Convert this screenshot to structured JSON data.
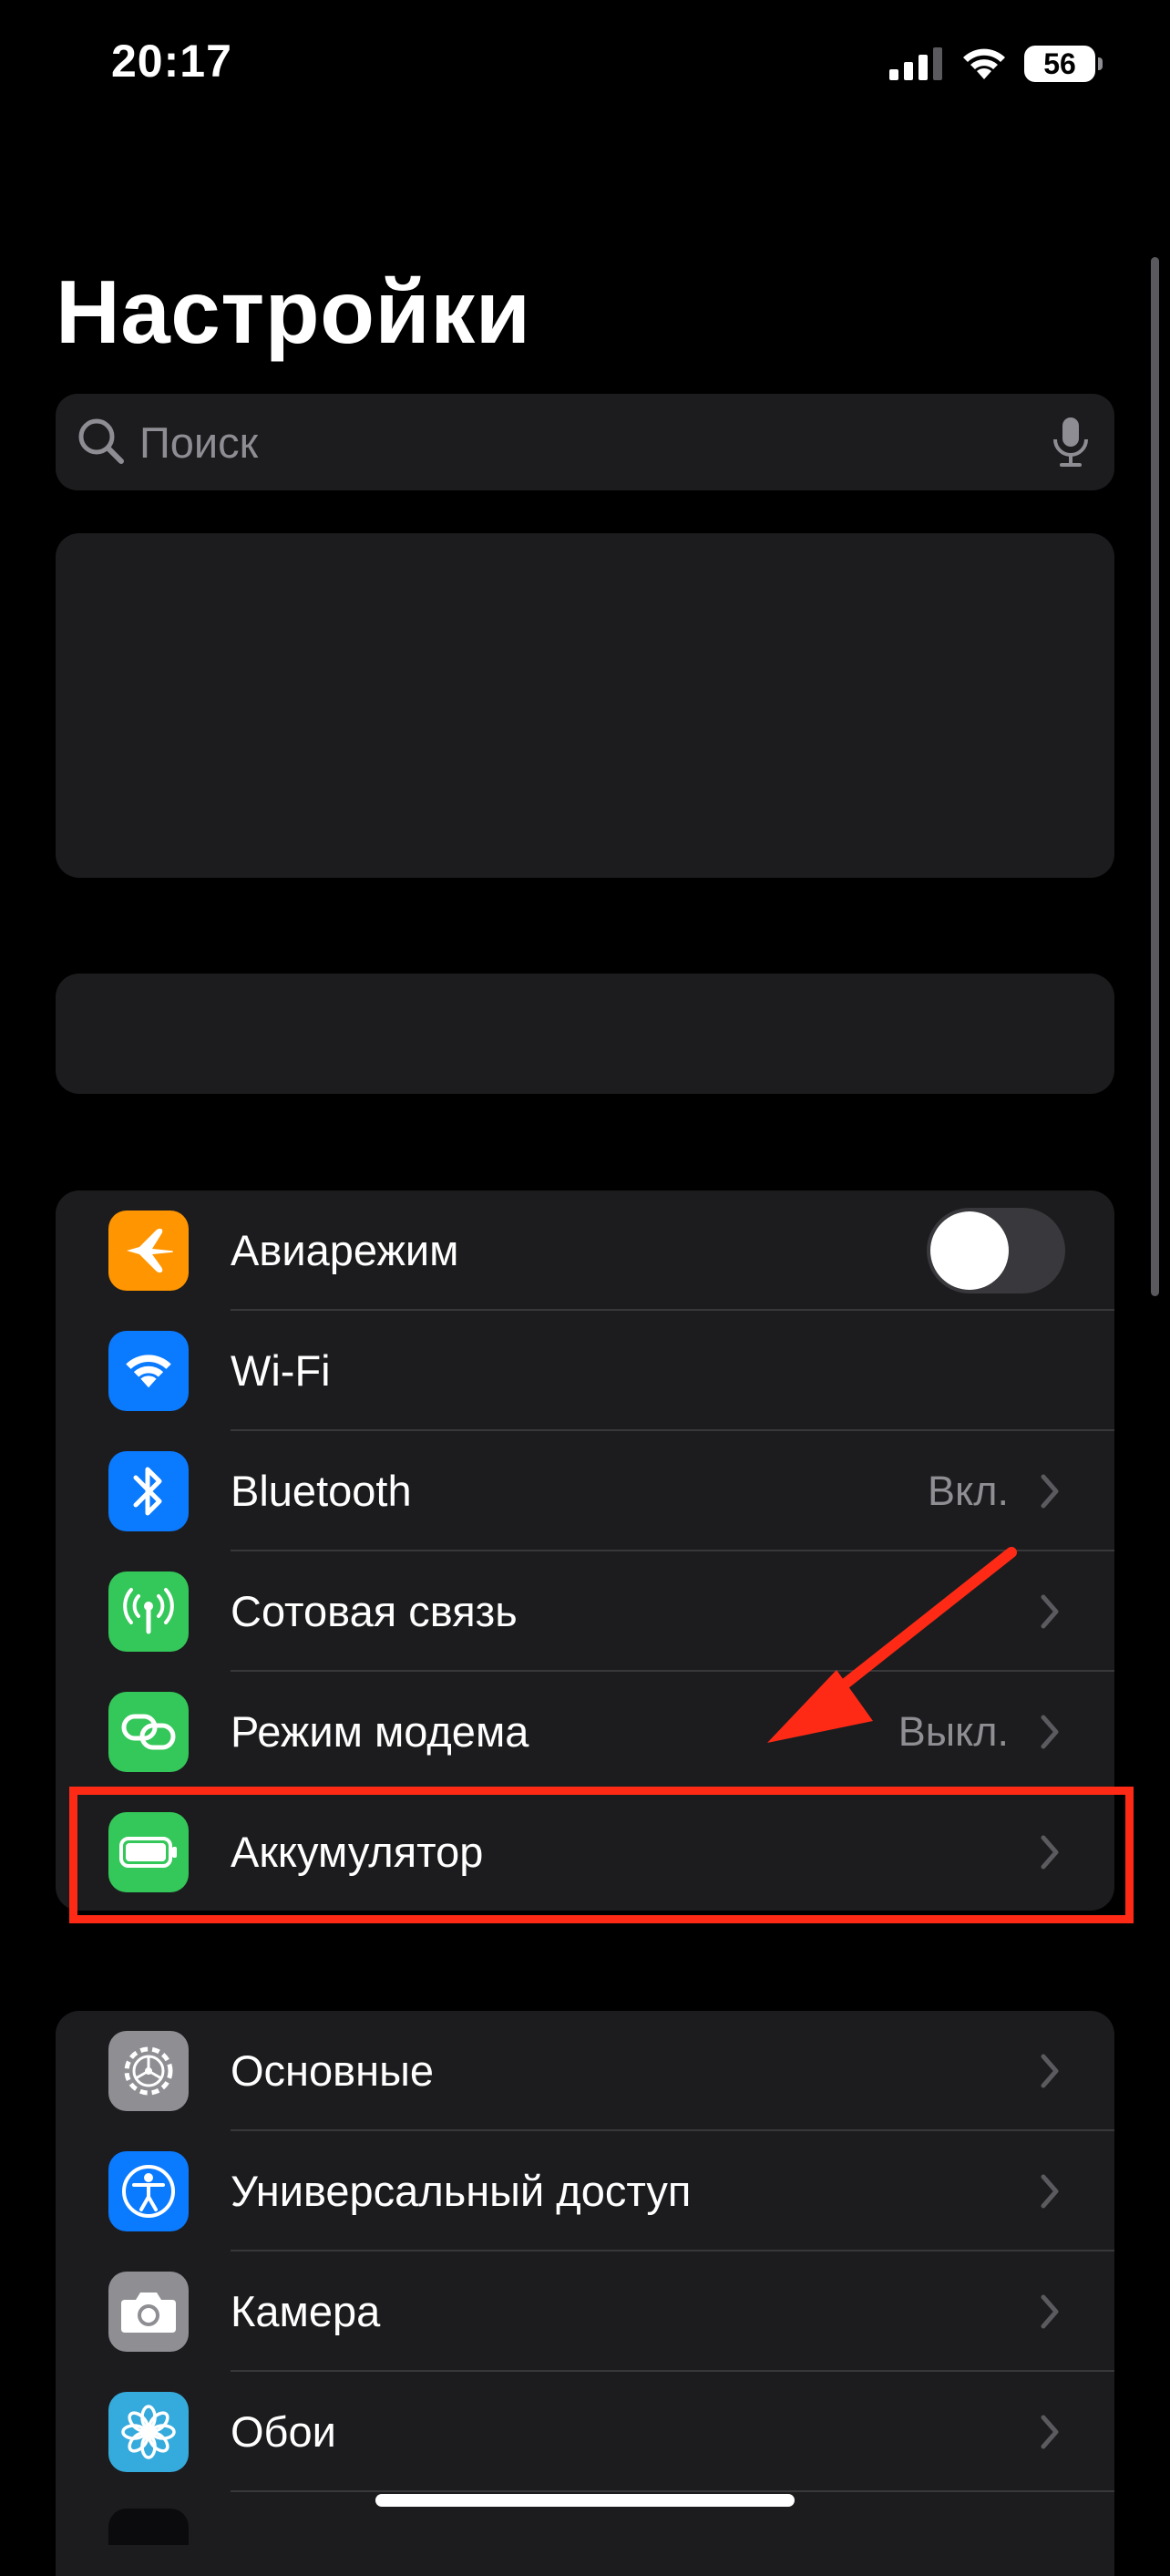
{
  "status_bar": {
    "time": "20:17",
    "battery": "56",
    "icons": [
      "cellular-signal-icon",
      "wifi-icon",
      "battery-icon"
    ]
  },
  "header": {
    "title": "Настройки"
  },
  "search": {
    "placeholder": "Поиск",
    "value": "",
    "icons": [
      "search-icon",
      "microphone-icon"
    ]
  },
  "network_group": {
    "items": [
      {
        "label": "Авиарежим",
        "icon": "airplane-icon",
        "color": "#ff9500",
        "toggle": false
      },
      {
        "label": "Wi-Fi",
        "icon": "wifi-icon",
        "color": "#0a7aff"
      },
      {
        "label": "Bluetooth",
        "icon": "bluetooth-icon",
        "color": "#0a7aff",
        "value": "Вкл."
      },
      {
        "label": "Сотовая связь",
        "icon": "antenna-icon",
        "color": "#34c759"
      },
      {
        "label": "Режим модема",
        "icon": "chain-link-icon",
        "color": "#34c759",
        "value": "Выкл."
      },
      {
        "label": "Аккумулятор",
        "icon": "battery-icon",
        "color": "#34c759"
      }
    ]
  },
  "general_group": {
    "items": [
      {
        "label": "Основные",
        "icon": "gear-icon",
        "color": "#8e8e93"
      },
      {
        "label": "Универсальный доступ",
        "icon": "accessibility-icon",
        "color": "#0a7aff"
      },
      {
        "label": "Камера",
        "icon": "camera-icon",
        "color": "#8e8e93"
      },
      {
        "label": "Обои",
        "icon": "flower-icon",
        "color": "#35aadc"
      }
    ]
  },
  "annotation": {
    "color": "#ff2a16",
    "highlighted_item": "Аккумулятор"
  }
}
